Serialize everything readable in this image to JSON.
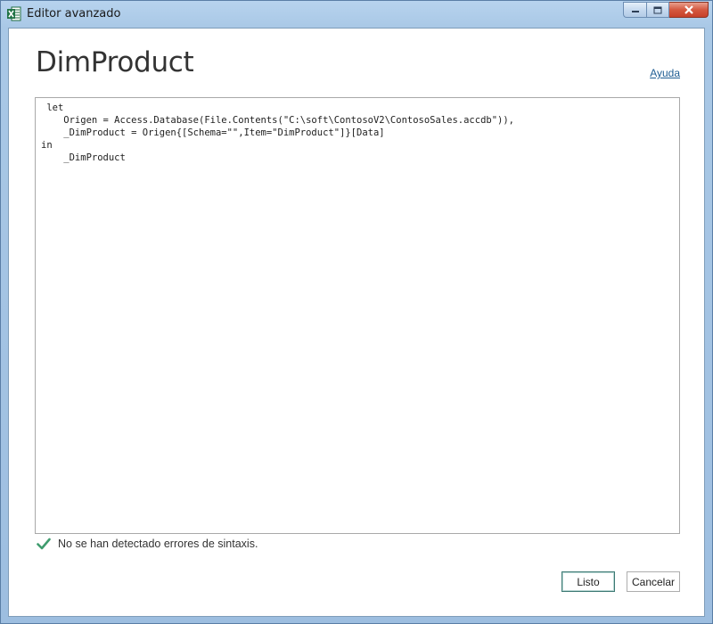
{
  "window": {
    "title": "Editor avanzado",
    "app_icon": "excel-icon",
    "controls": [
      "minimize-icon",
      "maximize-icon",
      "close-icon"
    ]
  },
  "dialog": {
    "heading": "DimProduct",
    "help_link": "Ayuda"
  },
  "editor": {
    "lines": [
      " let",
      "    Origen = Access.Database(File.Contents(\"C:\\soft\\ContosoV2\\ContosoSales.accdb\")),",
      "    _DimProduct = Origen{[Schema=\"\",Item=\"DimProduct\"]}[Data]",
      "in",
      "    _DimProduct"
    ]
  },
  "status": {
    "icon": "checkmark-icon",
    "text": "No se han detectado errores de sintaxis."
  },
  "buttons": {
    "ok_label": "Listo",
    "cancel_label": "Cancelar"
  },
  "colors": {
    "accent": "#217346",
    "status_check": "#3f9c6e",
    "link": "#1f5d93"
  }
}
